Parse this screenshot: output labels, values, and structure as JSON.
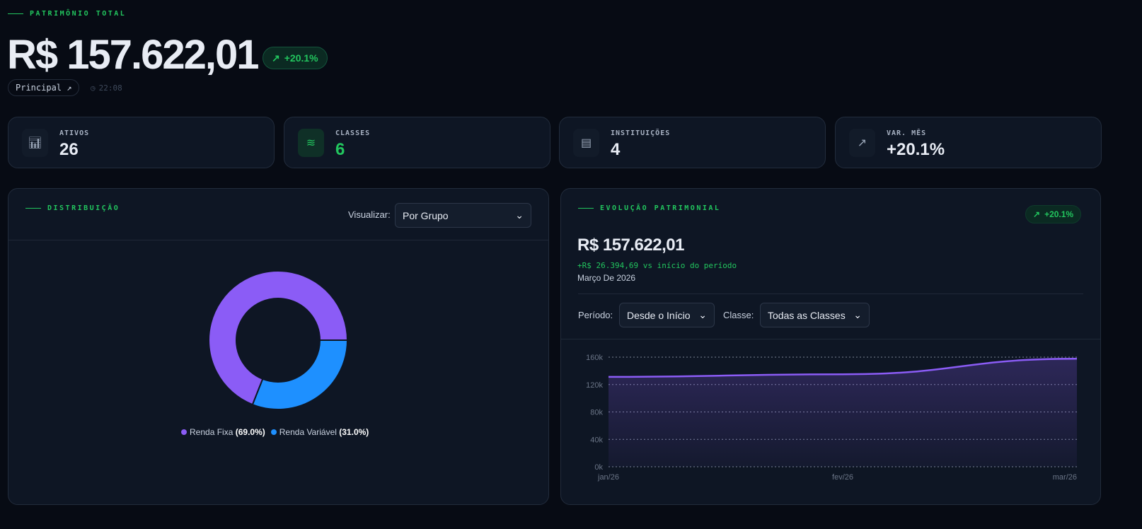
{
  "header": {
    "kicker": "PATRIMÔNIO TOTAL",
    "total": "R$ 157.622,01",
    "change": "+20.1%",
    "portfolio": "Principal ↗",
    "time": "22:08"
  },
  "stats": [
    {
      "label": "ATIVOS",
      "value": "26",
      "icon": "bar-chart-icon"
    },
    {
      "label": "CLASSES",
      "value": "6",
      "icon": "layers-icon"
    },
    {
      "label": "INSTITUIÇÕES",
      "value": "4",
      "icon": "building-icon"
    },
    {
      "label": "VAR. MÊS",
      "value": "+20.1%",
      "icon": "trending-up-icon"
    }
  ],
  "distribution": {
    "kicker": "DISTRIBUIÇÃO",
    "view_label": "Visualizar:",
    "view_value": "Por Grupo",
    "slices": [
      {
        "name": "Renda Fixa",
        "pct": "(69.0%)",
        "value": 69.0,
        "color": "#8b5cf6"
      },
      {
        "name": "Renda Variável",
        "pct": "(31.0%)",
        "value": 31.0,
        "color": "#1e90ff"
      }
    ]
  },
  "evolution": {
    "kicker": "EVOLUÇÃO PATRIMONIAL",
    "badge": "+20.1%",
    "value": "R$ 157.622,01",
    "delta": "+R$ 26.394,69 vs início do período",
    "date": "Março De 2026",
    "period_label": "Período:",
    "period_value": "Desde o Início",
    "class_label": "Classe:",
    "class_value": "Todas as Classes"
  },
  "chart_data": {
    "type": "area",
    "x": [
      "jan/26",
      "fev/26",
      "mar/26"
    ],
    "values": [
      131227.32,
      135000,
      157622.01
    ],
    "yticks": [
      "0k",
      "40k",
      "80k",
      "120k",
      "160k"
    ],
    "ylim": [
      0,
      160000
    ],
    "grid": true,
    "color": "#8b5cf6"
  }
}
